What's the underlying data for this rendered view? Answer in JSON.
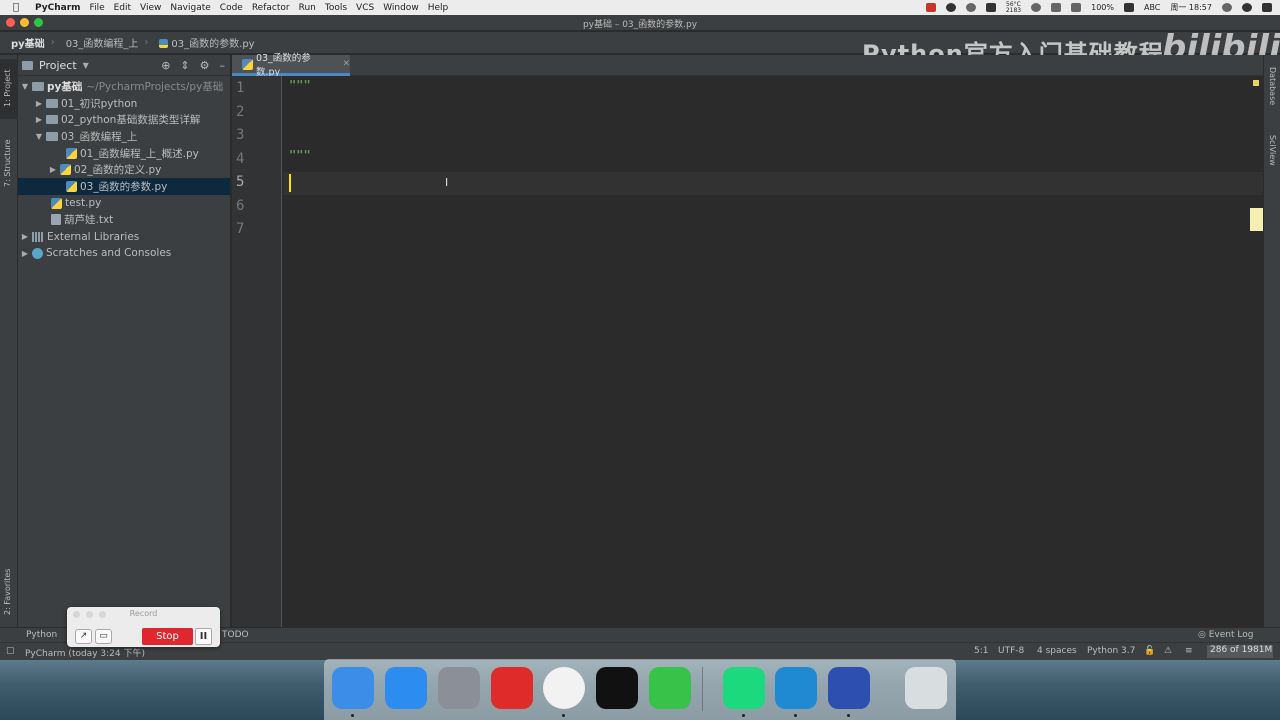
{
  "menubar": {
    "app_name": "PyCharm",
    "items": [
      "File",
      "Edit",
      "View",
      "Navigate",
      "Code",
      "Refactor",
      "Run",
      "Tools",
      "VCS",
      "Window",
      "Help"
    ],
    "battery": "100%",
    "input_method": "ABC",
    "clock": "周一 18:57",
    "cpu_temp": "56°C",
    "fan": "2183"
  },
  "window": {
    "title": "py基础 – 03_函数的参数.py"
  },
  "breadcrumbs": [
    "py基础",
    "03_函数编程_上",
    "03_函数的参数.py"
  ],
  "watermark": {
    "text": "Python官方入门基础教程",
    "logo": "bilibili"
  },
  "left_strip": {
    "project_label": "1: Project",
    "structure_label": "7: Structure",
    "favorites_label": "2: Favorites"
  },
  "right_strip": {
    "database_label": "Database",
    "sciview_label": "SciView"
  },
  "project_panel": {
    "title": "Project",
    "root": {
      "name": "py基础",
      "path": "~/PycharmProjects/py基础"
    },
    "items": [
      {
        "name": "01_初识python",
        "type": "folder"
      },
      {
        "name": "02_python基础数据类型详解",
        "type": "folder"
      },
      {
        "name": "03_函数编程_上",
        "type": "folder"
      },
      {
        "name": "01_函数编程_上_概述.py",
        "type": "py"
      },
      {
        "name": "02_函数的定义.py",
        "type": "py"
      },
      {
        "name": "03_函数的参数.py",
        "type": "py"
      },
      {
        "name": "test.py",
        "type": "py"
      },
      {
        "name": "葫芦娃.txt",
        "type": "txt"
      },
      {
        "name": "External Libraries",
        "type": "lib"
      },
      {
        "name": "Scratches and Consoles",
        "type": "scratch"
      }
    ]
  },
  "editor": {
    "active_tab": "03_函数的参数.py",
    "line_numbers": [
      "1",
      "2",
      "3",
      "4",
      "5",
      "6",
      "7"
    ],
    "lines": [
      "\"\"\"",
      "",
      "",
      "\"\"\"",
      "",
      "",
      ""
    ],
    "current_line": 5
  },
  "bottom_bar": {
    "python_console": "Python",
    "todo": "TODO",
    "event_log": "Event Log"
  },
  "status_bar": {
    "message": "PyCharm                    (today 3:24 下午)",
    "position": "5:1",
    "encoding": "UTF-8",
    "indent": "4 spaces",
    "interpreter": "Python 3.7",
    "memory": "286 of 1981M"
  },
  "record_widget": {
    "title": "Record",
    "stop_label": "Stop",
    "pause_label": "II"
  },
  "dock": {
    "apps": [
      "Finder",
      "Safari",
      "Launchpad",
      "NetEase Music",
      "Chrome",
      "QQ",
      "WeChat",
      "PyCharm",
      "VS Code",
      "Thunder",
      "Trash"
    ],
    "colors": [
      "#3c8de8",
      "#2d8cf0",
      "#8a8f98",
      "#e02b2b",
      "#f2f2f2",
      "#111111",
      "#38c24a",
      "#1cd97e",
      "#1f8ad2",
      "#2c4fb0",
      "#d8dde0"
    ]
  }
}
